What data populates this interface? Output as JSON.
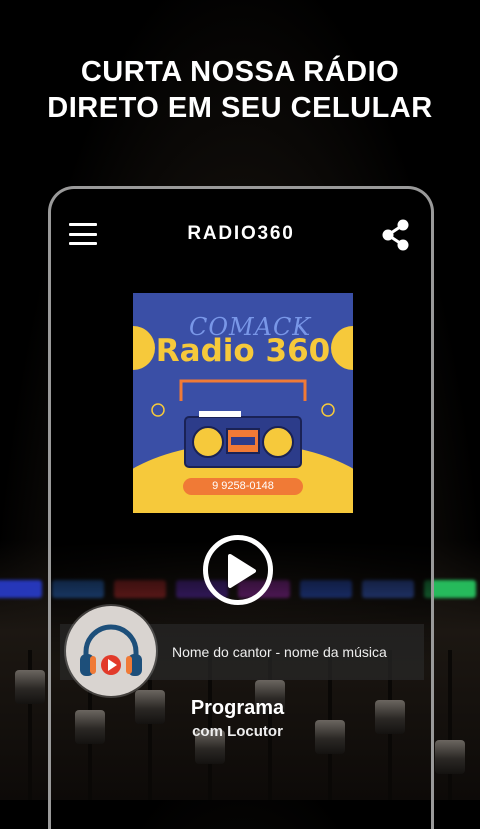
{
  "headline": {
    "line1": "CURTA NOSSA RÁDIO",
    "line2": "DIRETO EM SEU CELULAR"
  },
  "app_bar": {
    "title": "RADIO360",
    "menu_icon": "hamburger-menu-icon",
    "share_icon": "share-icon"
  },
  "artwork": {
    "script_text": "COMACK",
    "brand": "Radio 360",
    "phone_number": "9 9258-0148",
    "colors": {
      "background": "#3a4fa6",
      "yellow": "#f6c93b",
      "orange": "#f07a36"
    }
  },
  "player": {
    "play_icon": "play-icon",
    "now_playing": "Nome do cantor - nome da música",
    "program_title": "Programa",
    "program_subtitle": "com Locutor",
    "avatar_icon": "headphones-play-icon"
  }
}
